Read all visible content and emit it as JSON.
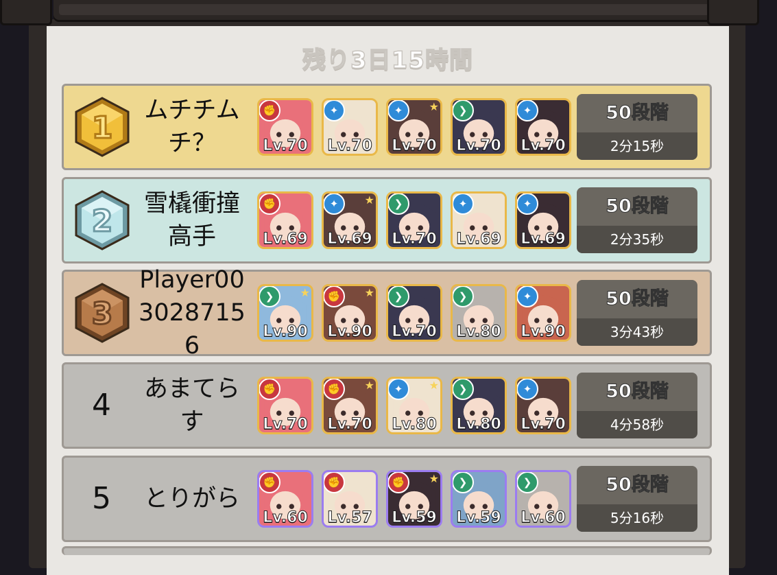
{
  "timer": "残り3日15時間",
  "rows": [
    {
      "rank": "1",
      "medal": "gold",
      "name": "ムチチムチ？",
      "score": "50段階",
      "time": "2分15秒",
      "row_color": "#eed890",
      "chars": [
        {
          "elem": "fire",
          "lv": "Lv.70",
          "star": false,
          "hair": "#e9707a",
          "frame": "gold"
        },
        {
          "elem": "ice",
          "lv": "Lv.70",
          "star": false,
          "hair": "#efe3cf",
          "frame": "gold"
        },
        {
          "elem": "ice",
          "lv": "Lv.70",
          "star": true,
          "hair": "#5a3e3a",
          "frame": "gold"
        },
        {
          "elem": "wind",
          "lv": "Lv.70",
          "star": false,
          "hair": "#3a3850",
          "frame": "gold"
        },
        {
          "elem": "ice",
          "lv": "Lv.70",
          "star": false,
          "hair": "#3a2c33",
          "frame": "gold"
        }
      ]
    },
    {
      "rank": "2",
      "medal": "silver",
      "name": "雪橇衝撞高手",
      "score": "50段階",
      "time": "2分35秒",
      "row_color": "#cce6e1",
      "chars": [
        {
          "elem": "fire",
          "lv": "Lv.69",
          "star": false,
          "hair": "#e9707a",
          "frame": "gold"
        },
        {
          "elem": "ice",
          "lv": "Lv.69",
          "star": true,
          "hair": "#5a3e3a",
          "frame": "gold"
        },
        {
          "elem": "wind",
          "lv": "Lv.70",
          "star": false,
          "hair": "#3a3850",
          "frame": "gold"
        },
        {
          "elem": "ice",
          "lv": "Lv.69",
          "star": false,
          "hair": "#efe3cf",
          "frame": "gold"
        },
        {
          "elem": "ice",
          "lv": "Lv.69",
          "star": false,
          "hair": "#3a2c33",
          "frame": "gold"
        }
      ]
    },
    {
      "rank": "3",
      "medal": "bronze",
      "name": "Player003028715 6",
      "score": "50段階",
      "time": "3分43秒",
      "row_color": "#d9bfa4",
      "chars": [
        {
          "elem": "wind",
          "lv": "Lv.90",
          "star": true,
          "hair": "#8fb9dd",
          "frame": "gold"
        },
        {
          "elem": "fire",
          "lv": "Lv.90",
          "star": true,
          "hair": "#7a4a3c",
          "frame": "gold"
        },
        {
          "elem": "wind",
          "lv": "Lv.70",
          "star": false,
          "hair": "#3a3850",
          "frame": "gold"
        },
        {
          "elem": "wind",
          "lv": "Lv.80",
          "star": false,
          "hair": "#b7b2ad",
          "frame": "gold"
        },
        {
          "elem": "ice",
          "lv": "Lv.90",
          "star": false,
          "hair": "#c9654f",
          "frame": "gold"
        }
      ]
    },
    {
      "rank": "4",
      "medal": "none",
      "name": "あまてらす",
      "score": "50段階",
      "time": "4分58秒",
      "row_color": "#bdbbb7",
      "chars": [
        {
          "elem": "fire",
          "lv": "Lv.70",
          "star": false,
          "hair": "#e9707a",
          "frame": "gold"
        },
        {
          "elem": "fire",
          "lv": "Lv.70",
          "star": true,
          "hair": "#7a4a3c",
          "frame": "gold"
        },
        {
          "elem": "ice",
          "lv": "Lv.80",
          "star": true,
          "hair": "#efe3cf",
          "frame": "gold"
        },
        {
          "elem": "wind",
          "lv": "Lv.80",
          "star": false,
          "hair": "#3a3850",
          "frame": "gold"
        },
        {
          "elem": "ice",
          "lv": "Lv.70",
          "star": false,
          "hair": "#5a3e3a",
          "frame": "gold"
        }
      ]
    },
    {
      "rank": "5",
      "medal": "none",
      "name": "とりがら",
      "score": "50段階",
      "time": "5分16秒",
      "row_color": "#bdbbb7",
      "chars": [
        {
          "elem": "fire",
          "lv": "Lv.60",
          "star": false,
          "hair": "#e9707a",
          "frame": "purple"
        },
        {
          "elem": "fire",
          "lv": "Lv.57",
          "star": false,
          "hair": "#efe3cf",
          "frame": "purple"
        },
        {
          "elem": "fire",
          "lv": "Lv.59",
          "star": true,
          "hair": "#3a2c33",
          "frame": "purple"
        },
        {
          "elem": "wind",
          "lv": "Lv.59",
          "star": false,
          "hair": "#7fa4c8",
          "frame": "purple"
        },
        {
          "elem": "wind",
          "lv": "Lv.60",
          "star": false,
          "hair": "#b7b2ad",
          "frame": "purple"
        }
      ]
    }
  ],
  "colors": {
    "gold": "#f1bf3a",
    "silver": "#bfe6ea",
    "bronze": "#b77b4a"
  }
}
